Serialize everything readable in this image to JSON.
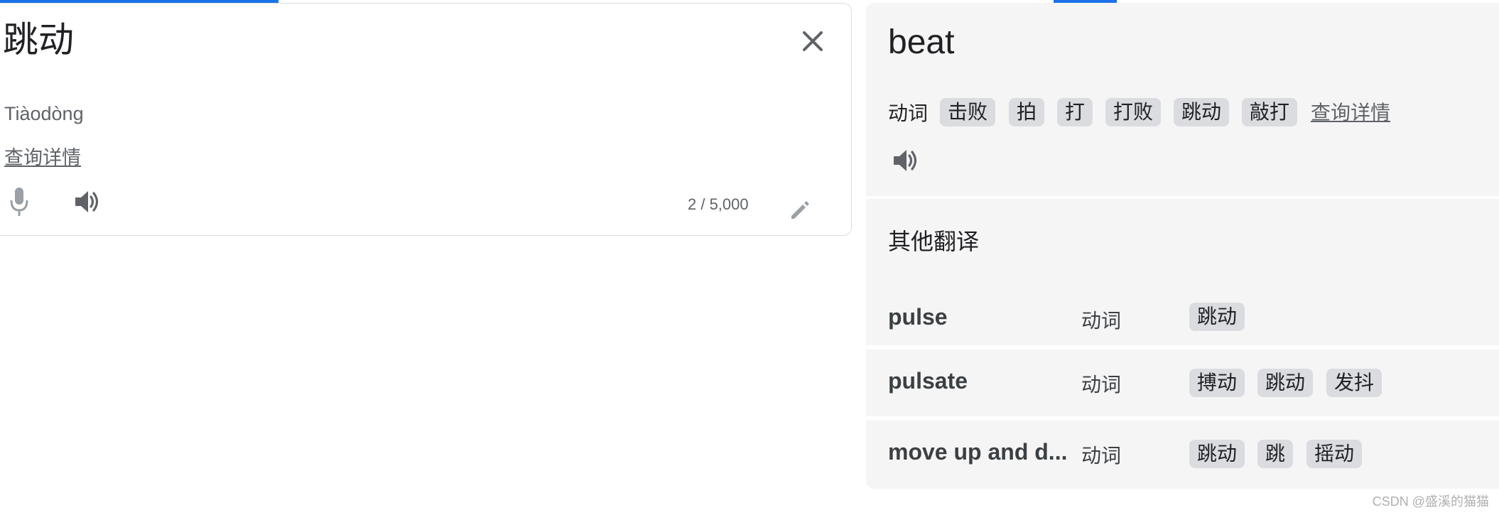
{
  "source": {
    "text": "跳动",
    "transliteration": "Tiàodòng",
    "details_link": "查询详情",
    "char_count": "2 / 5,000",
    "icons": {
      "close": "close-icon",
      "mic": "microphone-icon",
      "speaker": "speaker-icon",
      "edit": "pencil-icon"
    }
  },
  "result": {
    "word": "beat",
    "pos": "动词",
    "synonyms": [
      "击败",
      "拍",
      "打",
      "打败",
      "跳动",
      "敲打"
    ],
    "details_link": "查询详情",
    "icons": {
      "speaker": "speaker-icon"
    }
  },
  "other_translations": {
    "title": "其他翻译",
    "rows": [
      {
        "word": "pulse",
        "pos": "动词",
        "translations": [
          "跳动"
        ]
      },
      {
        "word": "pulsate",
        "pos": "动词",
        "translations": [
          "搏动",
          "跳动",
          "发抖"
        ]
      },
      {
        "word": "move up and d...",
        "pos": "动词",
        "translations": [
          "跳动",
          "跳",
          "摇动"
        ]
      }
    ]
  },
  "watermark": "CSDN @盛溪的猫猫",
  "colors": {
    "accent": "#1a73e8",
    "panel_bg": "#f5f5f5",
    "chip_bg": "#dadce0",
    "muted": "#5f6368"
  }
}
